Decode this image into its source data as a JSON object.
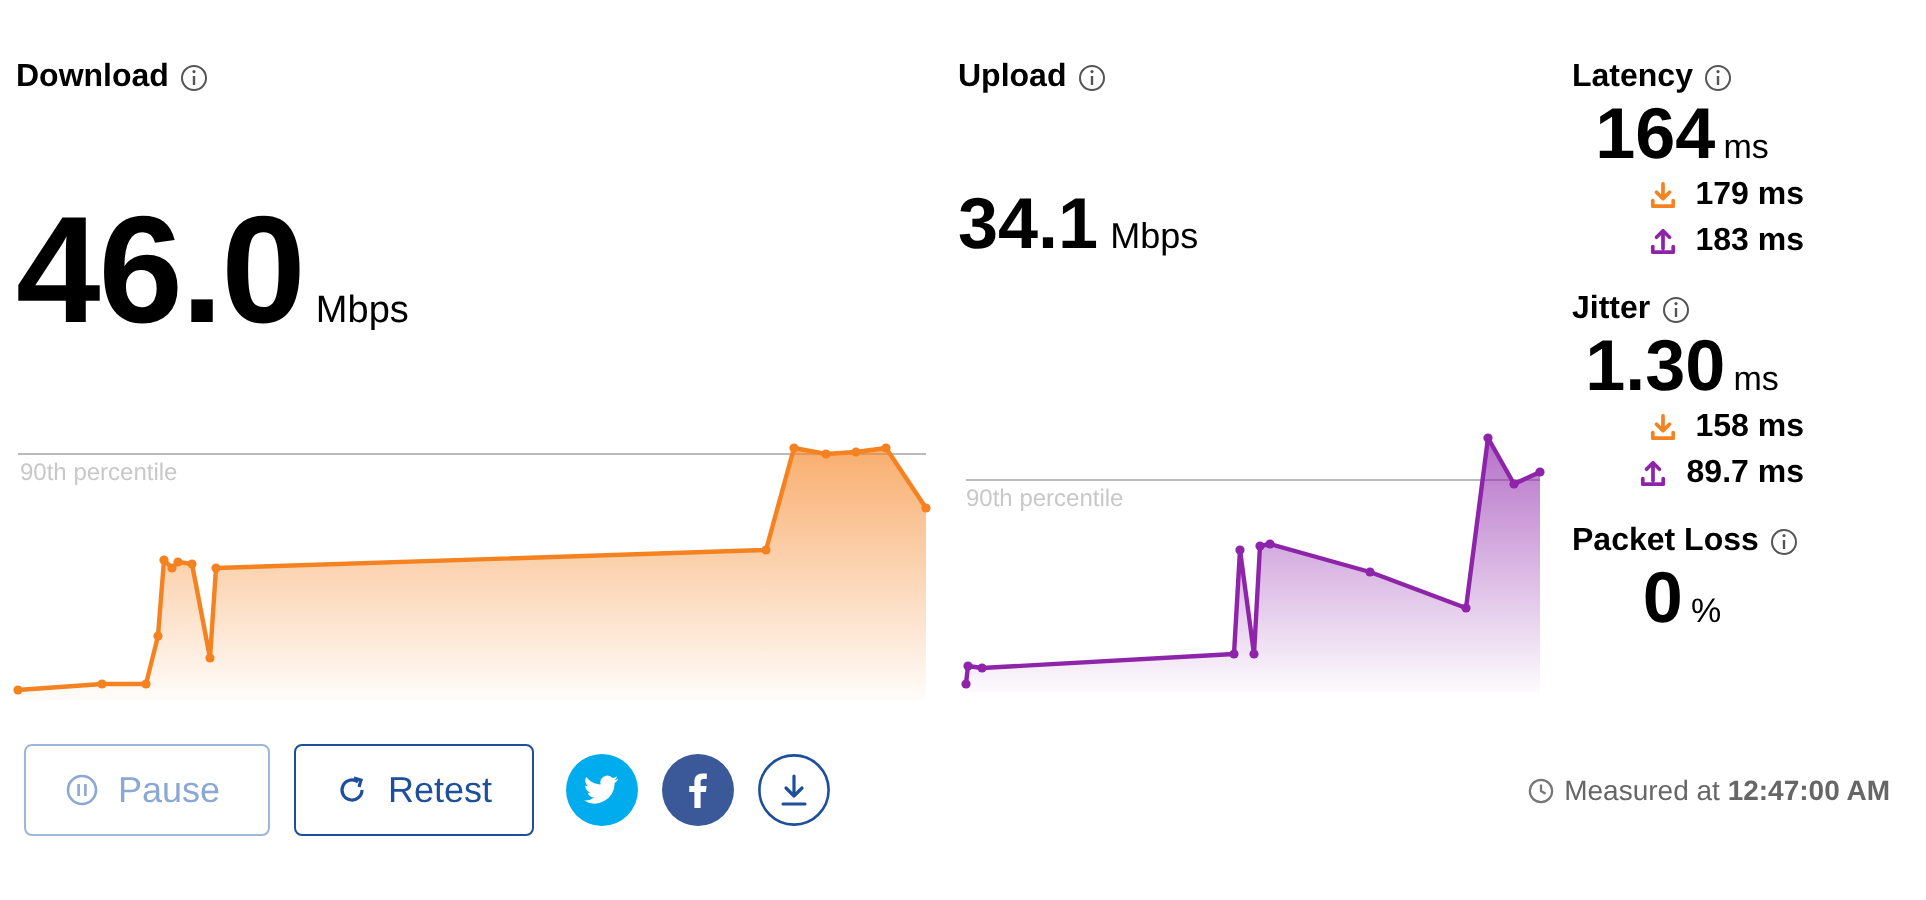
{
  "download": {
    "label": "Download",
    "value": "46.0",
    "unit": "Mbps",
    "percentile_label": "90th percentile"
  },
  "upload": {
    "label": "Upload",
    "value": "34.1",
    "unit": "Mbps",
    "percentile_label": "90th percentile"
  },
  "stats": [
    {
      "label": "Latency",
      "value": "164",
      "unit": "ms",
      "details": [
        {
          "kind": "download",
          "value": "179",
          "unit": "ms"
        },
        {
          "kind": "upload",
          "value": "183",
          "unit": "ms"
        }
      ]
    },
    {
      "label": "Jitter",
      "value": "1.30",
      "unit": "ms",
      "details": [
        {
          "kind": "download",
          "value": "158",
          "unit": "ms"
        },
        {
          "kind": "upload",
          "value": "89.7",
          "unit": "ms"
        }
      ]
    },
    {
      "label": "Packet Loss",
      "value": "0",
      "unit": "%"
    }
  ],
  "buttons": [
    {
      "kind": "pause",
      "label": "Pause",
      "disabled": true
    },
    {
      "kind": "retest",
      "label": "Retest",
      "disabled": false
    }
  ],
  "share": [
    {
      "kind": "twitter"
    },
    {
      "kind": "facebook"
    },
    {
      "kind": "save"
    }
  ],
  "measured": "Measured at **12:47:00 AM**"
}
